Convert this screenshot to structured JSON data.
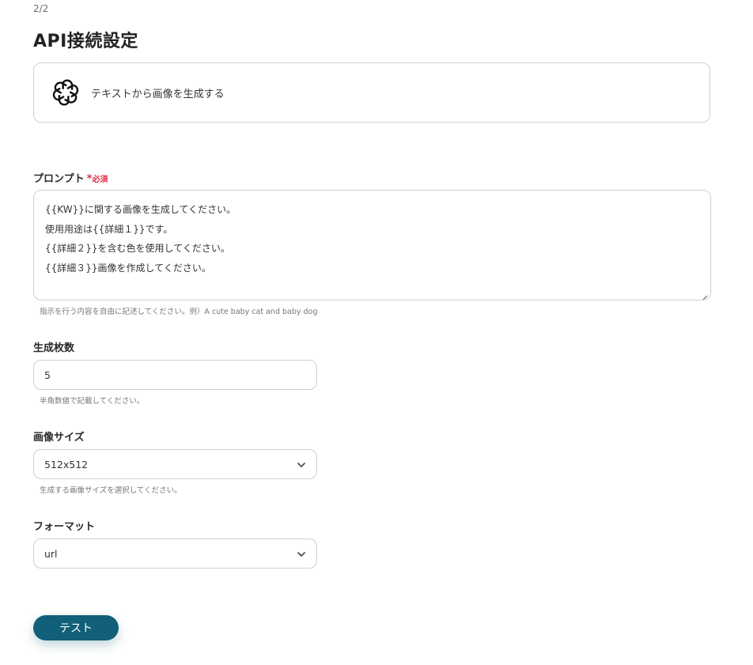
{
  "header": {
    "step": "2/2",
    "title": "API接続設定"
  },
  "action": {
    "icon": "openai-logo-icon",
    "label": "テキストから画像を生成する"
  },
  "prompt": {
    "label": "プロンプト",
    "required_mark": "*",
    "required_text": "必須",
    "lines": [
      "{{KW}}に関する画像を生成してください。",
      "使用用途は{{詳細１}}です。",
      "{{詳細２}}を含む色を使用してください。",
      "{{詳細３}}画像を作成してください。"
    ],
    "hint": "指示を行う内容を自由に記述してください。例）A cute baby cat and baby dog"
  },
  "count": {
    "label": "生成枚数",
    "value": "5",
    "hint": "半角数値で記載してください。"
  },
  "size": {
    "label": "画像サイズ",
    "value": "512x512",
    "hint": "生成する画像サイズを選択してください。"
  },
  "format": {
    "label": "フォーマット",
    "value": "url"
  },
  "test_button": {
    "label": "テスト"
  },
  "colors": {
    "accent": "#115f78",
    "required": "#e0303f",
    "border": "#cfcfcf"
  }
}
